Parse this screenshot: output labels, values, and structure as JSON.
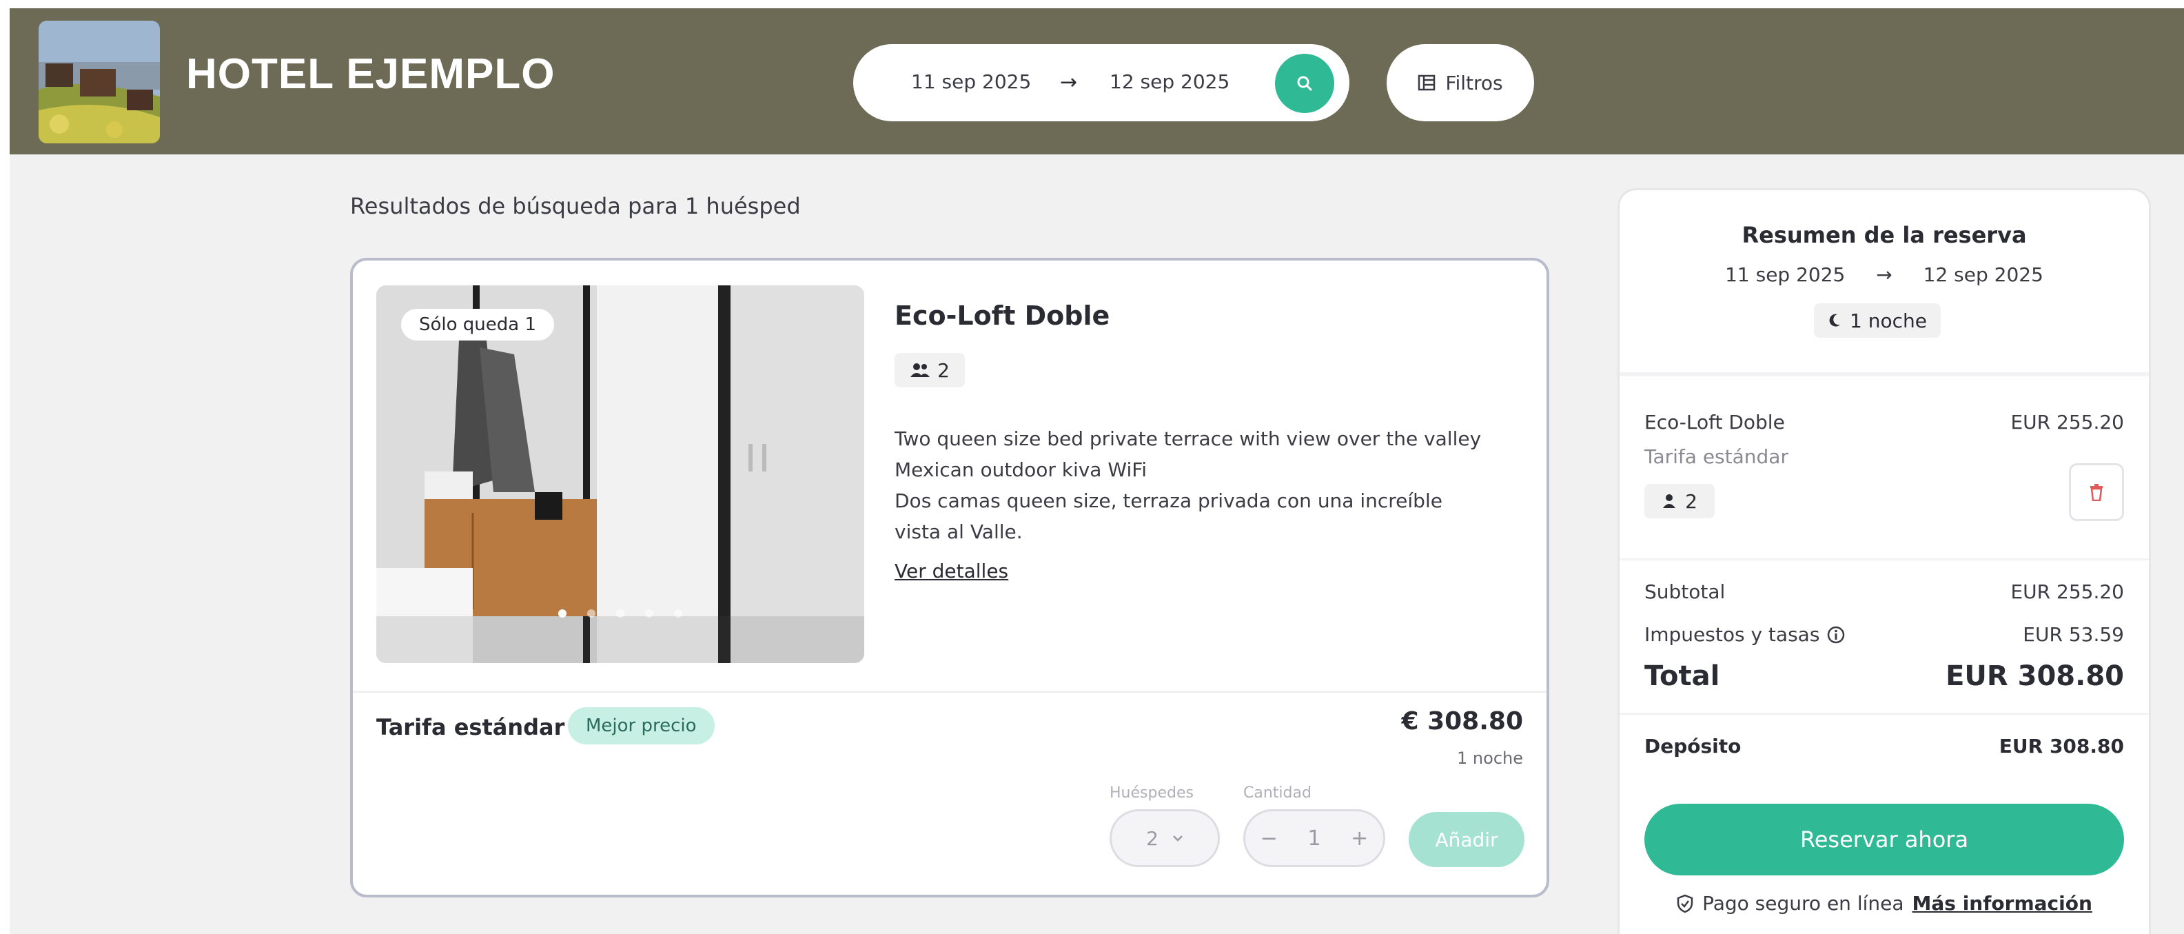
{
  "colors": {
    "header_bg": "#6d6a55",
    "accent": "#2fb995",
    "accent_light": "#a6e2d2",
    "badge_bg": "#c7efe4",
    "danger": "#e05858"
  },
  "header": {
    "hotel_name": "HOTEL EJEMPLO",
    "search": {
      "check_in": "11 sep 2025",
      "arrow": "→",
      "check_out": "12 sep 2025",
      "search_icon": "search-icon"
    },
    "filters_label": "Filtros",
    "filters_icon": "filters-icon"
  },
  "results": {
    "label": "Resultados de búsqueda para 1 huésped"
  },
  "room": {
    "availability_badge": "Sólo queda 1",
    "name": "Eco-Loft Doble",
    "capacity": "2",
    "description_lines": [
      "Two queen size bed private terrace with view over the valley",
      "Mexican outdoor kiva WiFi",
      "Dos camas queen size, terraza privada con una increíble",
      "vista al Valle."
    ],
    "details_link": "Ver detalles",
    "rate": {
      "name": "Tarifa estándar",
      "badge": "Mejor precio",
      "price": "€ 308.80",
      "nights": "1 noche",
      "guests_label": "Huéspedes",
      "guests_value": "2",
      "quantity_label": "Cantidad",
      "quantity_value": "1",
      "minus": "−",
      "plus": "+",
      "add_label": "Añadir"
    }
  },
  "summary": {
    "title": "Resumen de la reserva",
    "check_in": "11 sep 2025",
    "arrow": "→",
    "check_out": "12 sep 2025",
    "nights": "1 noche",
    "room_name": "Eco-Loft Doble",
    "room_price": "EUR 255.20",
    "room_rate": "Tarifa estándar",
    "room_capacity": "2",
    "subtotal_label": "Subtotal",
    "subtotal_value": "EUR 255.20",
    "taxes_label": "Impuestos y tasas",
    "taxes_value": "EUR 53.59",
    "total_label": "Total",
    "total_value": "EUR 308.80",
    "deposit_label": "Depósito",
    "deposit_value": "EUR 308.80",
    "reserve_label": "Reservar ahora",
    "secure_text": "Pago seguro en línea",
    "more_info": "Más información"
  }
}
